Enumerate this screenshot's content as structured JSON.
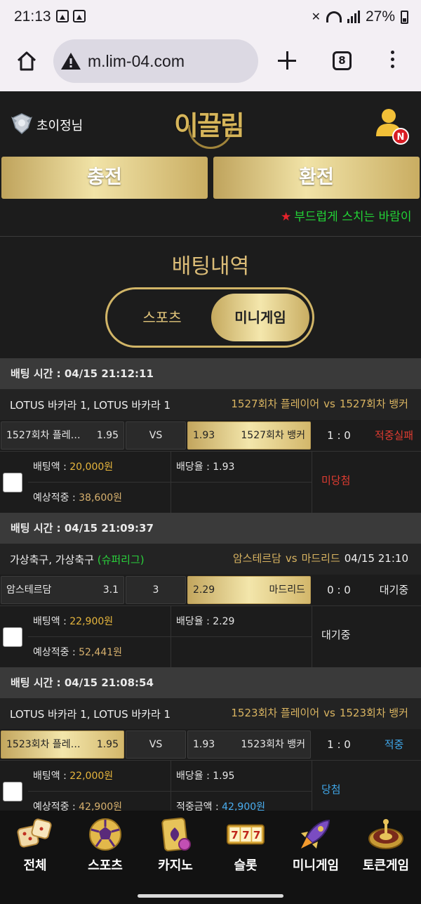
{
  "status_bar": {
    "time": "21:13",
    "battery": "27%"
  },
  "browser": {
    "url": "m.lim-04.com",
    "tab_count": "8"
  },
  "header": {
    "username": "초이정님",
    "logo_text": "이끌림",
    "notif_badge": "N"
  },
  "actions": {
    "charge": "충전",
    "exchange": "환전"
  },
  "notice": {
    "star": "★",
    "text": "부드럽게 스치는 바람이"
  },
  "section": {
    "title": "배팅내역",
    "tab_sports": "스포츠",
    "tab_mini": "미니게임"
  },
  "bets": [
    {
      "time_label": "배팅 시간 : 04/15 21:12:11",
      "game": "LOTUS 바카라 1, LOTUS 바카라 1",
      "league": "",
      "match_home": "1527회차 플레이어",
      "match_vs": "vs",
      "match_away": "1527회차 뱅커",
      "match_date": "",
      "home_name": "1527회차 플레…",
      "home_odds": "1.95",
      "mid": "VS",
      "away_odds": "1.93",
      "away_name": "1527회차 뱅커",
      "score": "1 : 0",
      "result": "적중실패",
      "bet_amount_label": "배팅액 : ",
      "bet_amount": "20,000원",
      "odds_label": "배당율 : ",
      "odds_value": "1.93",
      "expected_label": "예상적중 : ",
      "expected_value": "38,600원",
      "win_label": "",
      "win_value": "",
      "status": "미당첨"
    },
    {
      "time_label": "배팅 시간 : 04/15 21:09:37",
      "game": "가상축구, 가상축구",
      "league": "(슈퍼리그)",
      "match_home": "암스테르담",
      "match_vs": "vs",
      "match_away": "마드리드",
      "match_date": "04/15 21:10",
      "home_name": "암스테르담",
      "home_odds": "3.1",
      "mid": "3",
      "away_odds": "2.29",
      "away_name": "마드리드",
      "score": "0 : 0",
      "result": "대기중",
      "bet_amount_label": "배팅액 : ",
      "bet_amount": "22,900원",
      "odds_label": "배당율 : ",
      "odds_value": "2.29",
      "expected_label": "예상적중 : ",
      "expected_value": "52,441원",
      "win_label": "",
      "win_value": "",
      "status": "대기중"
    },
    {
      "time_label": "배팅 시간 : 04/15 21:08:54",
      "game": "LOTUS 바카라 1, LOTUS 바카라 1",
      "league": "",
      "match_home": "1523회차 플레이어",
      "match_vs": "vs",
      "match_away": "1523회차 뱅커",
      "match_date": "",
      "home_name": "1523회차 플레…",
      "home_odds": "1.95",
      "mid": "VS",
      "away_odds": "1.93",
      "away_name": "1523회차 뱅커",
      "score": "1 : 0",
      "result": "적중",
      "bet_amount_label": "배팅액 : ",
      "bet_amount": "22,000원",
      "odds_label": "배당율 : ",
      "odds_value": "1.95",
      "expected_label": "예상적중 : ",
      "expected_value": "42,900원",
      "win_label": "적중금액 : ",
      "win_value": "42,900원",
      "status": "당첨"
    }
  ],
  "nav": [
    {
      "label": "전체",
      "icon": "dice-icon"
    },
    {
      "label": "스포츠",
      "icon": "soccer-ball-icon"
    },
    {
      "label": "카지노",
      "icon": "playing-card-icon"
    },
    {
      "label": "슬롯",
      "icon": "slot-777-icon"
    },
    {
      "label": "미니게임",
      "icon": "rocket-icon"
    },
    {
      "label": "토큰게임",
      "icon": "roulette-icon"
    }
  ],
  "colors": {
    "gold": "#d6b55a",
    "background": "#1c1c1c",
    "win": "#3fa6e8",
    "fail": "#e03c31",
    "league": "#2ad13b"
  }
}
